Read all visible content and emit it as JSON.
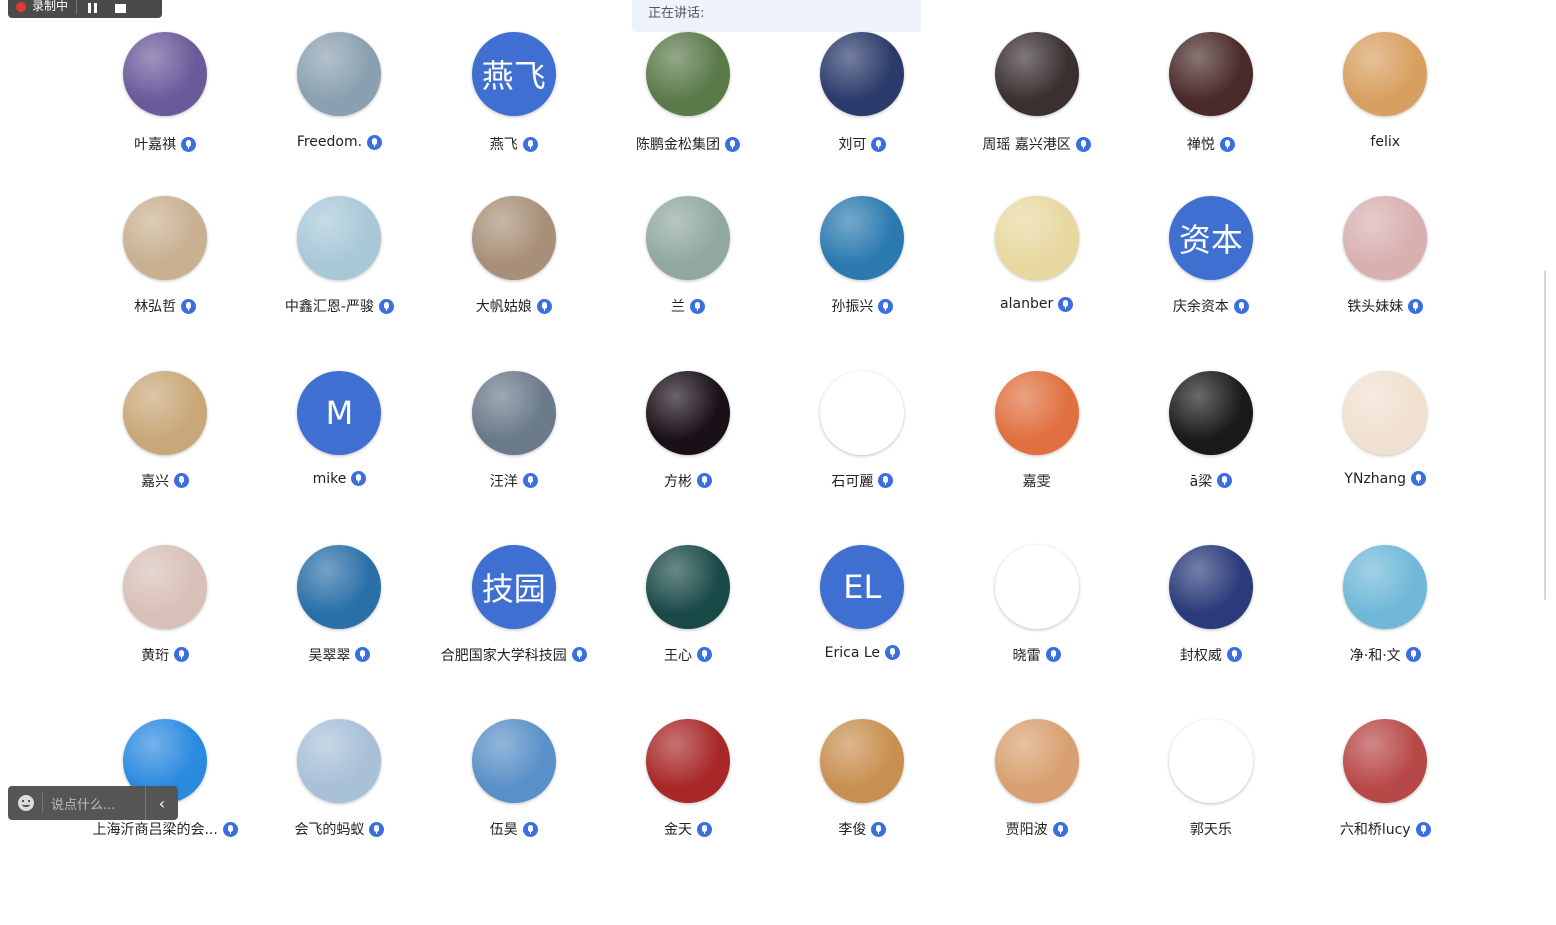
{
  "recording": {
    "label": "录制中"
  },
  "speaking": {
    "label": "正在讲话:"
  },
  "chat": {
    "placeholder": "说点什么..."
  },
  "participants": [
    {
      "name": "叶嘉祺",
      "avatar": "photo",
      "bg": "#6a5a9a",
      "mic": true
    },
    {
      "name": "Freedom.",
      "avatar": "photo",
      "bg": "#8aa0b0",
      "mic": true
    },
    {
      "name": "燕飞",
      "avatar": "letter",
      "text": "燕飞",
      "mic": true
    },
    {
      "name": "陈鹏金松集团",
      "avatar": "photo",
      "bg": "#5a7a4a",
      "mic": true
    },
    {
      "name": "刘可",
      "avatar": "photo",
      "bg": "#2a3a6a",
      "mic": true
    },
    {
      "name": "周瑶 嘉兴港区",
      "avatar": "photo",
      "bg": "#3a3030",
      "mic": true
    },
    {
      "name": "禅悦",
      "avatar": "photo",
      "bg": "#4a2a2a",
      "mic": true
    },
    {
      "name": "felix",
      "avatar": "photo",
      "bg": "#d8a060",
      "mic": false
    },
    {
      "name": "林弘哲",
      "avatar": "photo",
      "bg": "#c8b090",
      "mic": true
    },
    {
      "name": "中鑫汇恩-严骏",
      "avatar": "photo",
      "bg": "#a8c8d8",
      "mic": true
    },
    {
      "name": "大帆姑娘",
      "avatar": "photo",
      "bg": "#a89078",
      "mic": true
    },
    {
      "name": "兰",
      "avatar": "photo",
      "bg": "#90a8a0",
      "mic": true
    },
    {
      "name": "孙振兴",
      "avatar": "photo",
      "bg": "#2a7ab0",
      "mic": true
    },
    {
      "name": "alanber",
      "avatar": "photo",
      "bg": "#e8d8a0",
      "mic": true
    },
    {
      "name": "庆余资本",
      "avatar": "letter",
      "text": "资本",
      "mic": true
    },
    {
      "name": "铁头妹妹",
      "avatar": "photo",
      "bg": "#d8b0b0",
      "mic": true
    },
    {
      "name": "嘉兴",
      "avatar": "photo",
      "bg": "#c8a878",
      "mic": true
    },
    {
      "name": "mike",
      "avatar": "letter",
      "text": "M",
      "mic": true
    },
    {
      "name": "汪洋",
      "avatar": "photo",
      "bg": "#6a7a8a",
      "mic": true
    },
    {
      "name": "方彬",
      "avatar": "photo",
      "bg": "#1a1018",
      "mic": true
    },
    {
      "name": "石可麗",
      "avatar": "photo",
      "bg": "#ffffff",
      "mic": true
    },
    {
      "name": "嘉雯",
      "avatar": "photo",
      "bg": "#e07040",
      "mic": false
    },
    {
      "name": "ā梁",
      "avatar": "photo",
      "bg": "#1a1a1a",
      "mic": true
    },
    {
      "name": "YNzhang",
      "avatar": "photo",
      "bg": "#f0e0d0",
      "mic": true
    },
    {
      "name": "黄珩",
      "avatar": "photo",
      "bg": "#d8c0b8",
      "mic": true
    },
    {
      "name": "吴翠翠",
      "avatar": "photo",
      "bg": "#2a70a8",
      "mic": true
    },
    {
      "name": "合肥国家大学科技园",
      "avatar": "letter",
      "text": "技园",
      "mic": true
    },
    {
      "name": "王心",
      "avatar": "photo",
      "bg": "#1a4a48",
      "mic": true
    },
    {
      "name": "Erica Le",
      "avatar": "letter",
      "text": "EL",
      "mic": true
    },
    {
      "name": "晓雷",
      "avatar": "photo",
      "bg": "#ffffff",
      "mic": true
    },
    {
      "name": "封权威",
      "avatar": "photo",
      "bg": "#2a3a7a",
      "mic": true
    },
    {
      "name": "净·和·文",
      "avatar": "photo",
      "bg": "#70b8d8",
      "mic": true
    },
    {
      "name": "上海沂商吕梁的会...",
      "avatar": "photo",
      "bg": "#2a8ae0",
      "mic": true
    },
    {
      "name": "会飞的蚂蚁",
      "avatar": "photo",
      "bg": "#a8c0d8",
      "mic": true
    },
    {
      "name": "伍昊",
      "avatar": "photo",
      "bg": "#5a90c8",
      "mic": true
    },
    {
      "name": "金天",
      "avatar": "photo",
      "bg": "#a82828",
      "mic": true
    },
    {
      "name": "李俊",
      "avatar": "photo",
      "bg": "#c89050",
      "mic": true
    },
    {
      "name": "贾阳波",
      "avatar": "photo",
      "bg": "#d8a070",
      "mic": true
    },
    {
      "name": "郭天乐",
      "avatar": "photo",
      "bg": "#ffffff",
      "mic": false
    },
    {
      "name": "六和桥lucy",
      "avatar": "photo",
      "bg": "#b84848",
      "mic": true
    }
  ]
}
